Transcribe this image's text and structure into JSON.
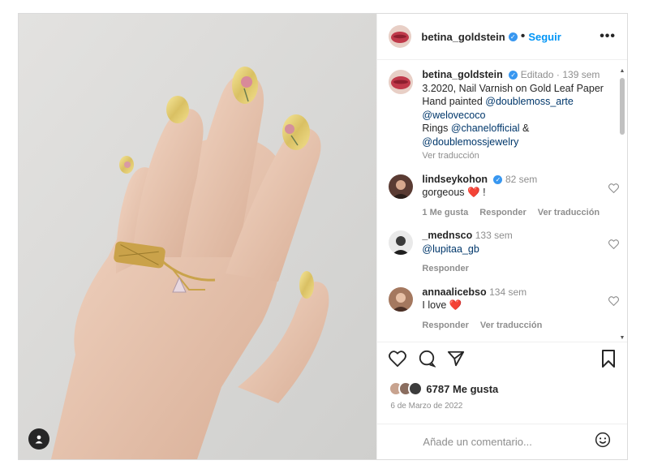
{
  "post": {
    "author": "betina_goldstein",
    "follow_label": "Seguir",
    "more_label": "•••"
  },
  "caption": {
    "username": "betina_goldstein",
    "edited": "Editado",
    "time": "139 sem",
    "line1": "3.2020, Nail Varnish on Gold Leaf Paper",
    "line2_prefix": "Hand painted ",
    "mention1": "@doublemoss_arte",
    "mention2": "@welovecoco",
    "line4_prefix": "Rings ",
    "mention3": "@chanelofficial",
    "line4_suffix": " &",
    "mention4": "@doublemossjewelry",
    "translate": "Ver traducción"
  },
  "comments": [
    {
      "username": "lindseykohon",
      "verified": true,
      "time": "82 sem",
      "text": "gorgeous",
      "emoji": "❤️",
      "suffix": " !",
      "likes": "1 Me gusta",
      "reply": "Responder",
      "translate": "Ver traducción"
    },
    {
      "username": "_mednsco",
      "time": "133 sem",
      "mention": "@lupitaa_gb",
      "reply": "Responder"
    },
    {
      "username": "annaalicebso",
      "time": "134 sem",
      "text": "I love",
      "emoji": "❤️",
      "reply": "Responder",
      "translate": "Ver traducción"
    }
  ],
  "likes": {
    "count": "6787 Me gusta",
    "date": "6 de Marzo de 2022"
  },
  "add_comment": {
    "placeholder": "Añade un comentario..."
  },
  "colors": {
    "accent": "#0095f6",
    "verified": "#3897f0",
    "heart": "#e0245e"
  }
}
